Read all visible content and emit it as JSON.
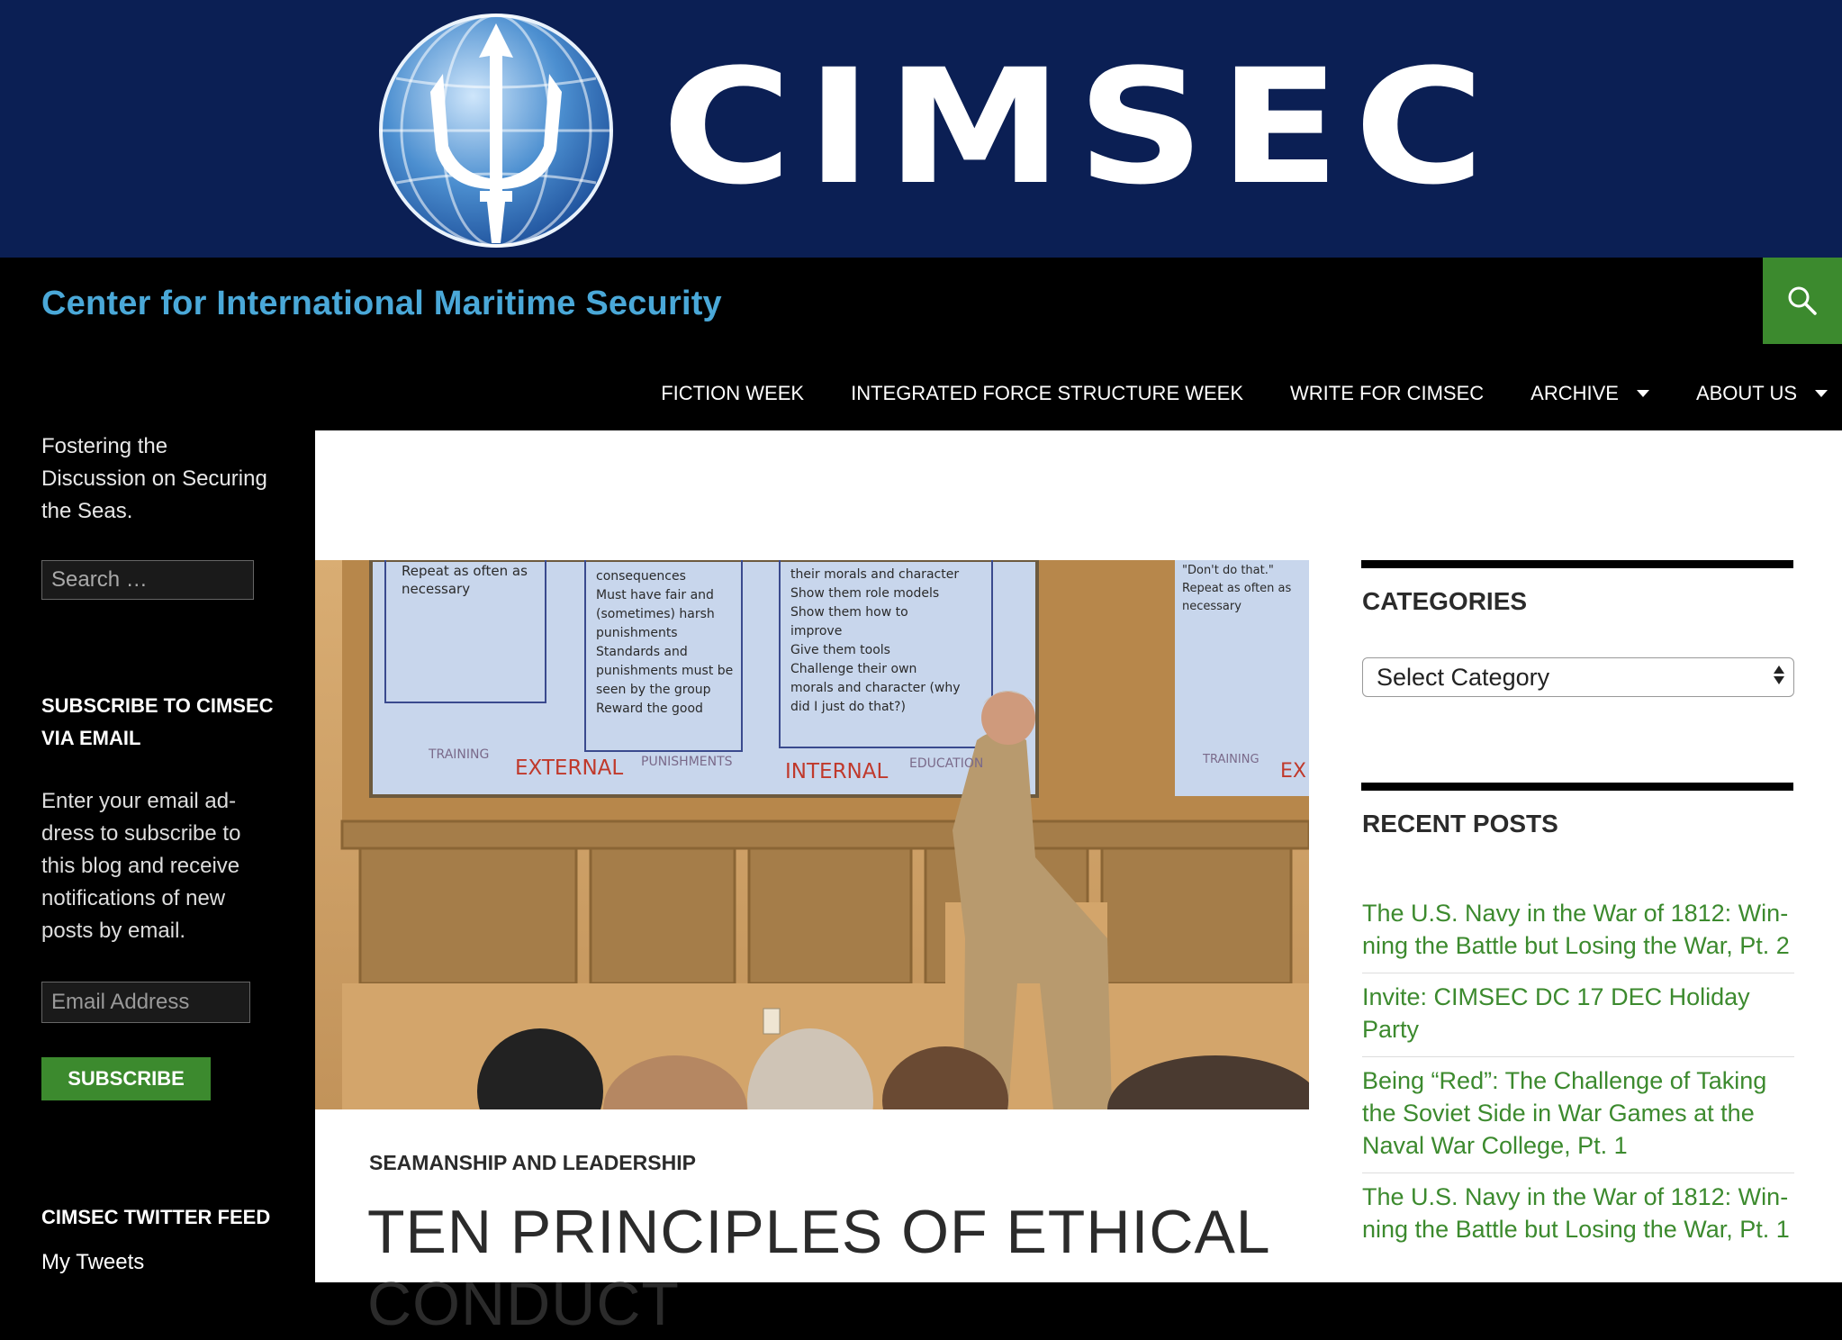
{
  "banner": {
    "wordmark": "CIMSEC"
  },
  "site": {
    "title": "Center for International Maritime Security"
  },
  "nav": [
    {
      "label": "FICTION WEEK",
      "dropdown": false
    },
    {
      "label": "INTEGRATED FORCE STRUCTURE WEEK",
      "dropdown": false
    },
    {
      "label": "WRITE FOR CIMSEC",
      "dropdown": false
    },
    {
      "label": "ARCHIVE",
      "dropdown": true
    },
    {
      "label": "ABOUT US",
      "dropdown": true
    }
  ],
  "left": {
    "tagline": "Fostering the Discussion on Securing the Seas.",
    "search_placeholder": "Search …",
    "subscribe_title": "SUBSCRIBE TO CIMSEC VIA EMAIL",
    "subscribe_desc": "Enter your email ad­dress to subscribe to this blog and receive notifications of new posts by email.",
    "email_placeholder": "Email Address",
    "subscribe_label": "SUBSCRIBE",
    "twitter_title": "CIMSEC TWITTER FEED",
    "my_tweets": "My Tweets"
  },
  "slide": {
    "col1": [
      "Repeat as often as",
      "necessary"
    ],
    "col2": [
      "consequences",
      "Must have fair and",
      "(sometimes) harsh",
      "punishments",
      "Standards and",
      "punishments must be",
      "seen by the group",
      "Reward the good"
    ],
    "col3": [
      "their morals and character",
      "Show them role models",
      "Show them how to",
      "improve",
      "Give them tools",
      "Challenge their own",
      "morals and character (why",
      "did I just do that?)"
    ],
    "col4": [
      "\"Don't do that.\"",
      "Repeat as often as",
      "necessary"
    ],
    "labels": {
      "training": "TRAINING",
      "external": "EXTERNAL",
      "punishments": "PUNISHMENTS",
      "internal": "INTERNAL",
      "education": "EDUCATION",
      "training2": "TRAINING",
      "ext2": "EX"
    }
  },
  "post": {
    "category": "SEAMANSHIP AND LEADERSHIP",
    "title": "TEN PRINCIPLES OF ETHICAL CONDUCT"
  },
  "right": {
    "categories_title": "CATEGORIES",
    "select_value": "Select Category",
    "recent_title": "RECENT POSTS",
    "recent_posts": [
      "The U.S. Navy in the War of 1812: Win­ning the Battle but Losing the War, Pt. 2",
      "Invite: CIMSEC DC 17 DEC Holiday Party",
      "Being “Red”: The Challenge of Taking the Soviet Side in War Games at the Naval War College, Pt. 1",
      "The U.S. Navy in the War of 1812: Win­ning the Battle but Losing the War, Pt. 1"
    ]
  },
  "colors": {
    "banner_bg": "#0b1f54",
    "site_title": "#4aa8d8",
    "accent_green": "#3c8a2e",
    "link_green": "#3c8a2e"
  },
  "icons": [
    "trident-globe-logo",
    "search-icon",
    "chevron-down-icon",
    "select-arrows-icon"
  ]
}
